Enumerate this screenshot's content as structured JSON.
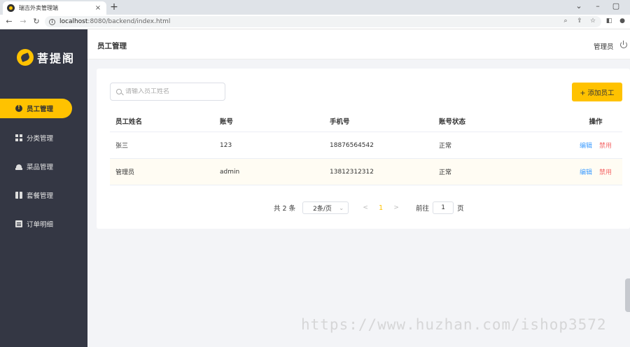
{
  "browser": {
    "tab_title": "瑞吉外卖管理端",
    "tab_close": "×",
    "new_tab": "+",
    "url_host": "localhost",
    "url_path": ":8080/backend/index.html",
    "icons": [
      "back-icon",
      "forward-icon",
      "reload-icon",
      "info-icon",
      "zoom-icon",
      "share-icon",
      "star-icon",
      "sidepanel-icon",
      "profile-icon"
    ]
  },
  "sidebar": {
    "logo_text": "菩提阁",
    "items": [
      {
        "label": "员工管理",
        "icon": "user-icon",
        "active": true
      },
      {
        "label": "分类管理",
        "icon": "grid-icon",
        "active": false
      },
      {
        "label": "菜品管理",
        "icon": "dish-icon",
        "active": false
      },
      {
        "label": "套餐管理",
        "icon": "gift-icon",
        "active": false
      },
      {
        "label": "订单明细",
        "icon": "clipboard-icon",
        "active": false
      }
    ]
  },
  "header": {
    "title": "员工管理",
    "admin": "管理员"
  },
  "toolbar": {
    "search_placeholder": "请输入员工姓名",
    "add_label": "+ 添加员工"
  },
  "table": {
    "columns": [
      "员工姓名",
      "账号",
      "手机号",
      "账号状态",
      "操作"
    ],
    "rows": [
      {
        "name": "张三",
        "account": "123",
        "phone": "18876564542",
        "status": "正常",
        "edit": "编辑",
        "disable": "禁用"
      },
      {
        "name": "管理员",
        "account": "admin",
        "phone": "13812312312",
        "status": "正常",
        "edit": "编辑",
        "disable": "禁用"
      }
    ]
  },
  "pagination": {
    "total": "共 2 条",
    "page_size": "2条/页",
    "prev": "<",
    "current": "1",
    "next": ">",
    "goto_prefix": "前往",
    "goto_value": "1",
    "goto_suffix": "页"
  },
  "watermark": "https://www.huzhan.com/ishop3572",
  "colors": {
    "accent": "#ffc200",
    "sidebar": "#343744",
    "link": "#419eff",
    "danger": "#f56c6c"
  }
}
